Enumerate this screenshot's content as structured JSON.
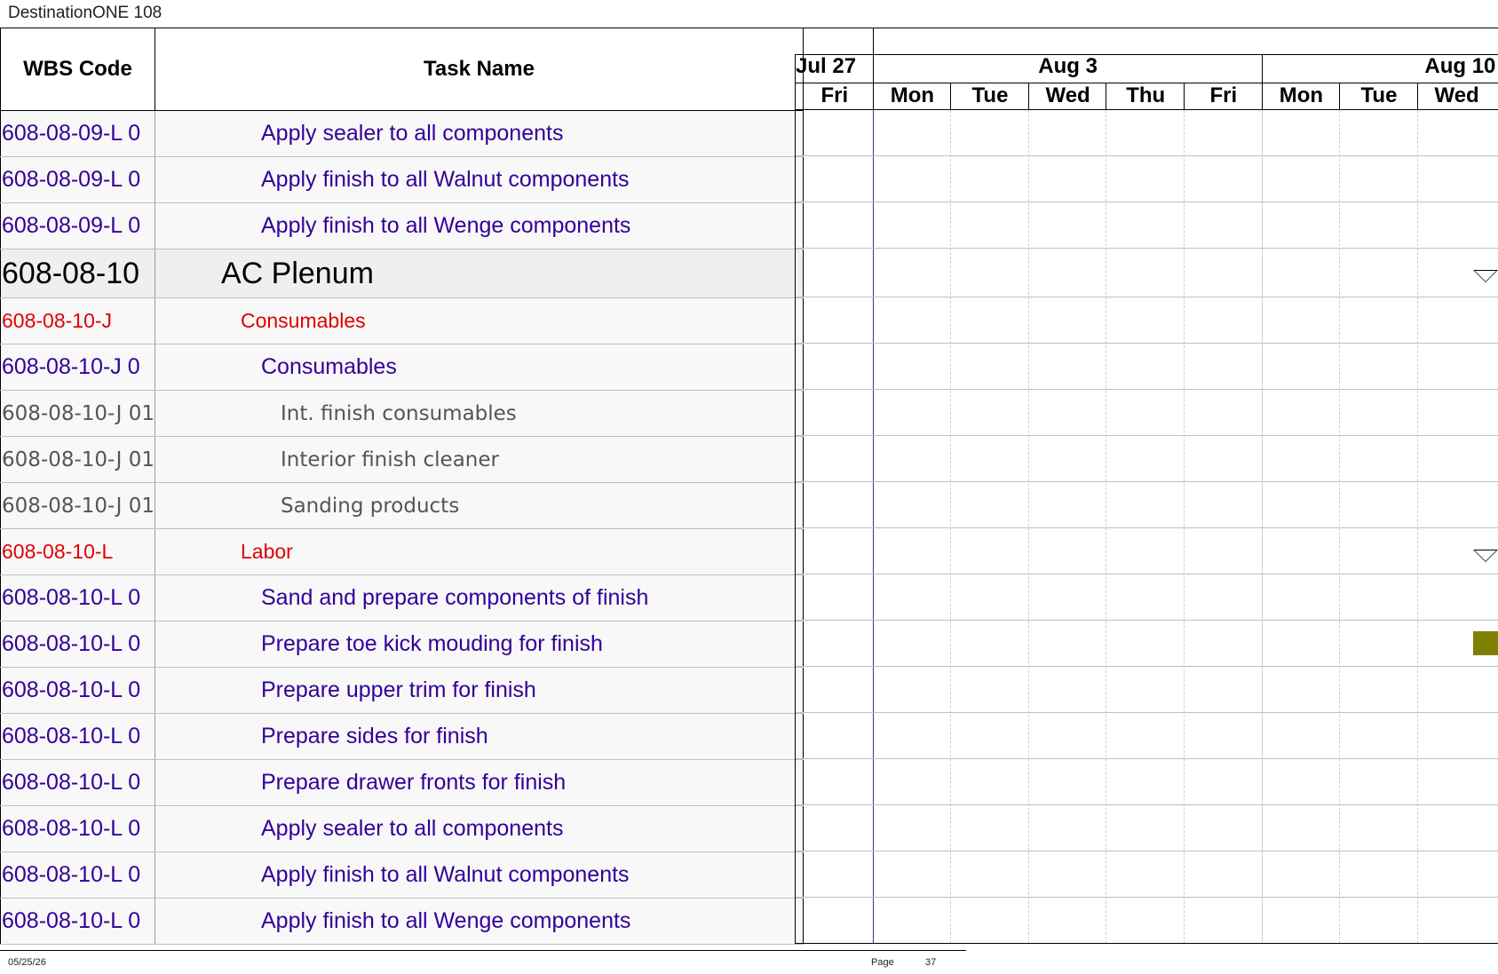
{
  "doc_title": "DestinationONE 108",
  "headers": {
    "wbs": "WBS Code",
    "task": "Task Name"
  },
  "timeline": {
    "weeks": [
      "Jul 27",
      "Aug 3",
      "Aug 10"
    ],
    "days": [
      "Fri",
      "Mon",
      "Tue",
      "Wed",
      "Thu",
      "Fri",
      "Mon",
      "Tue",
      "Wed"
    ]
  },
  "rows": [
    {
      "wbs": "608-08-09-L 0",
      "task": "Apply sealer to all components",
      "level": 3
    },
    {
      "wbs": "608-08-09-L 0",
      "task": "Apply finish to all Walnut components",
      "level": 3
    },
    {
      "wbs": "608-08-09-L 0",
      "task": "Apply finish to all Wenge components",
      "level": 3
    },
    {
      "wbs": "608-08-10",
      "task": "AC Plenum",
      "level": 1
    },
    {
      "wbs": "608-08-10-J",
      "task": "Consumables",
      "level": 2
    },
    {
      "wbs": "608-08-10-J 0",
      "task": "Consumables",
      "level": 3
    },
    {
      "wbs": "608-08-10-J 01",
      "task": "Int. finish consumables",
      "level": 4
    },
    {
      "wbs": "608-08-10-J 01",
      "task": "Interior finish cleaner",
      "level": 4
    },
    {
      "wbs": "608-08-10-J 01",
      "task": "Sanding products",
      "level": 4
    },
    {
      "wbs": "608-08-10-L",
      "task": "Labor",
      "level": 2
    },
    {
      "wbs": "608-08-10-L 0",
      "task": "Sand and prepare components of finish",
      "level": 3
    },
    {
      "wbs": "608-08-10-L 0",
      "task": "Prepare toe kick mouding for finish",
      "level": 3
    },
    {
      "wbs": "608-08-10-L 0",
      "task": "Prepare upper trim for finish",
      "level": 3
    },
    {
      "wbs": "608-08-10-L 0",
      "task": "Prepare sides for finish",
      "level": 3
    },
    {
      "wbs": "608-08-10-L 0",
      "task": "Prepare drawer fronts for finish",
      "level": 3
    },
    {
      "wbs": "608-08-10-L 0",
      "task": "Apply sealer to all components",
      "level": 3
    },
    {
      "wbs": "608-08-10-L 0",
      "task": "Apply finish to all Walnut components",
      "level": 3
    },
    {
      "wbs": "608-08-10-L 0",
      "task": "Apply finish to all Wenge components",
      "level": 3
    }
  ],
  "bar_color": "#7f7f00",
  "footer": {
    "date": "05/25/26",
    "page_label": "Page",
    "page_number": "37"
  }
}
